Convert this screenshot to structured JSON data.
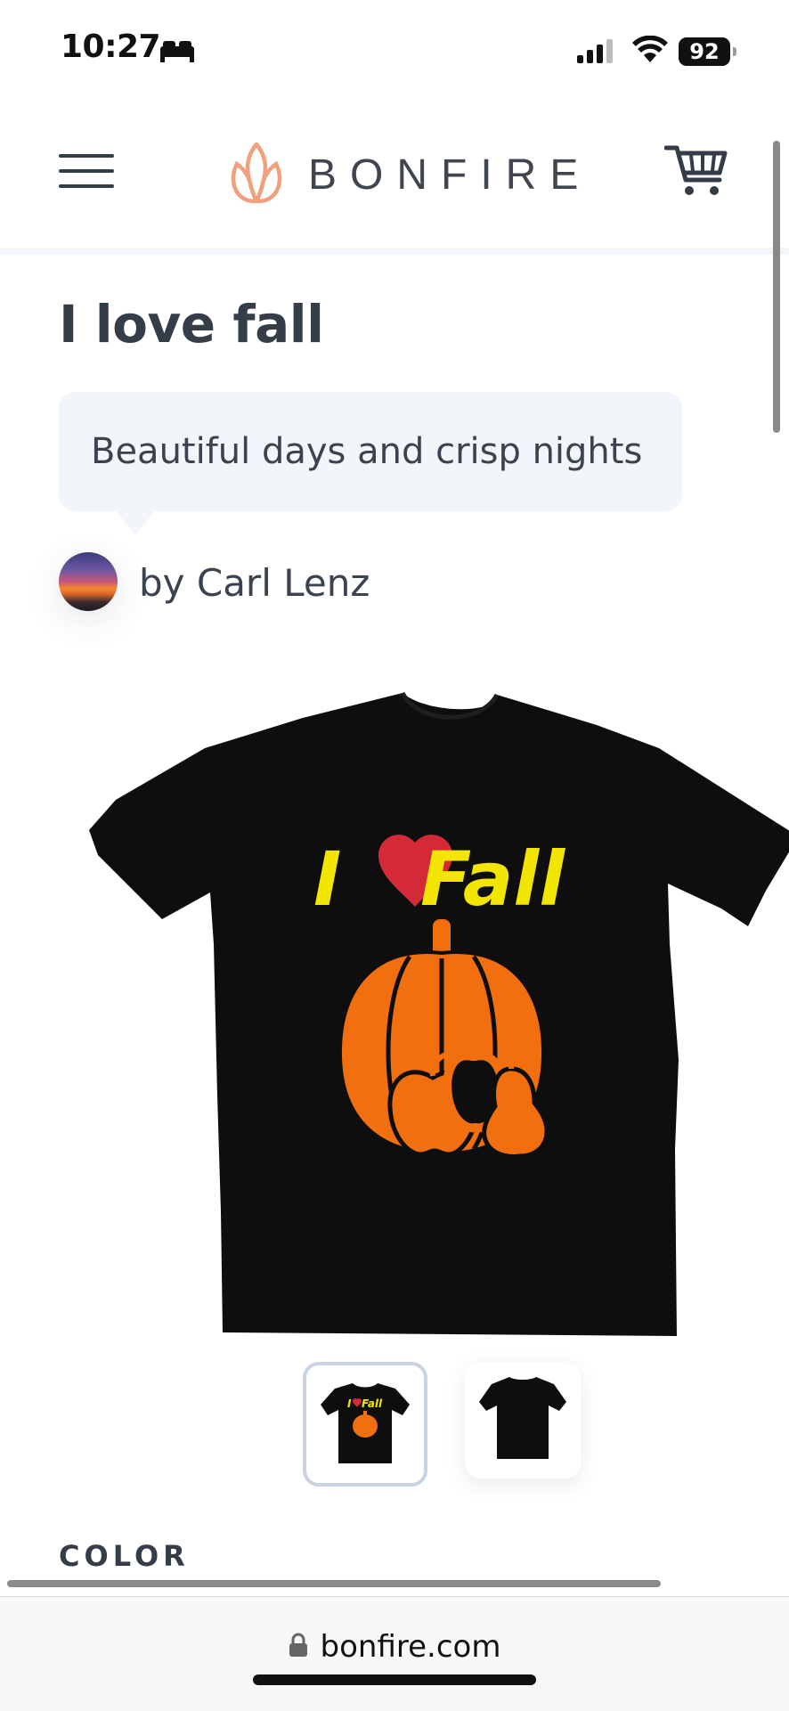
{
  "status_bar": {
    "time": "10:27",
    "battery": "92",
    "icons": [
      "bed-icon",
      "signal-icon",
      "wifi-icon",
      "battery-icon"
    ]
  },
  "header": {
    "brand": "BONFIRE",
    "icons": [
      "menu-icon",
      "flame-logo-icon",
      "cart-icon"
    ],
    "brand_color": "#f0a07c"
  },
  "product": {
    "title": "I love fall",
    "description": "Beautiful days and crisp nights",
    "author": "by Carl Lenz",
    "shirt_color": "#0e0e0e",
    "graphic": {
      "headline_left": "I",
      "headline_right": "Fall",
      "headline_color": "#f2e600",
      "heart_color": "#d42a37",
      "pumpkin_color": "#f26f0f"
    },
    "thumbnails": [
      {
        "name": "front",
        "selected": true
      },
      {
        "name": "back",
        "selected": false
      }
    ]
  },
  "options": {
    "color_label": "COLOR"
  },
  "browser": {
    "url": "bonfire.com",
    "icons": [
      "lock-icon"
    ]
  }
}
